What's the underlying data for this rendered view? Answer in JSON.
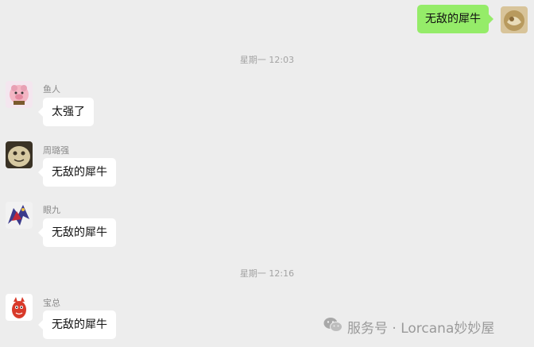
{
  "colors": {
    "background": "#ededed",
    "outgoing_bubble": "#95ec69",
    "incoming_bubble": "#ffffff",
    "timestamp_text": "#a3a3a3",
    "sender_text": "#8a8a8a"
  },
  "outgoing": {
    "text": "无敌的犀牛",
    "avatar_icon": "user-avatar-icon"
  },
  "timestamps": [
    "星期一 12:03",
    "星期一 12:16"
  ],
  "messages": [
    {
      "sender": "鱼人",
      "text": "太强了",
      "avatar_icon": "pig-sticker-avatar-icon"
    },
    {
      "sender": "周璐强",
      "text": "无敌的犀牛",
      "avatar_icon": "blob-avatar-icon"
    },
    {
      "sender": "眼九",
      "text": "无敌的犀牛",
      "avatar_icon": "dragon-avatar-icon"
    },
    {
      "sender": "宝总",
      "text": "无敌的犀牛",
      "avatar_icon": "red-character-avatar-icon"
    }
  ],
  "watermark": {
    "text": "服务号 · Lorcana妙妙屋",
    "icon": "wechat-icon"
  }
}
